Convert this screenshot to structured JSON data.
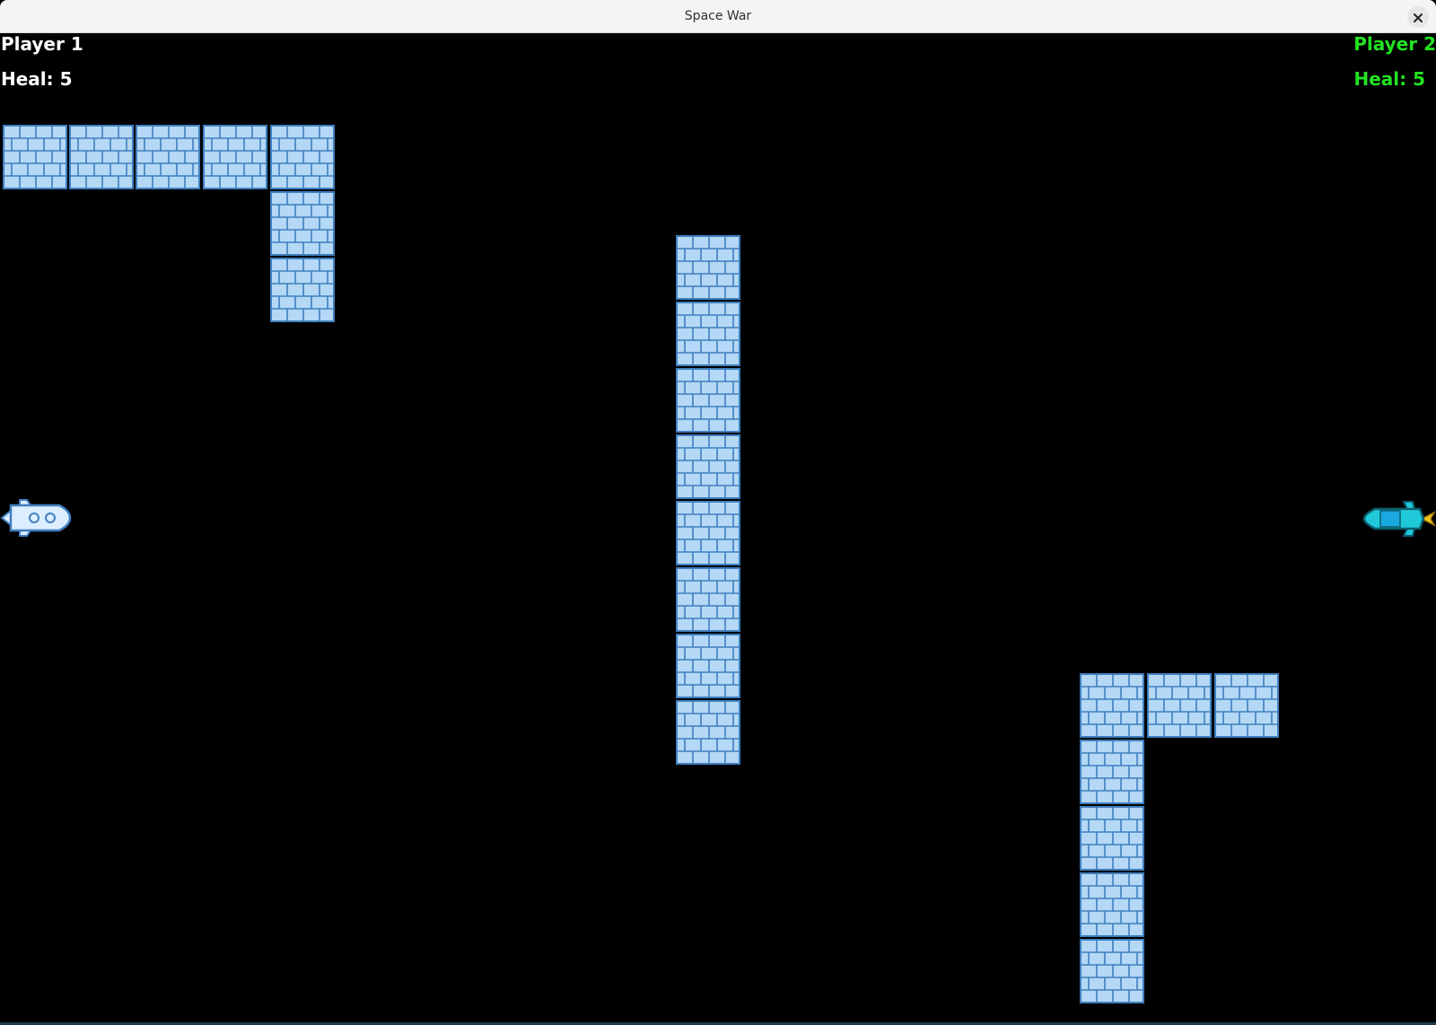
{
  "window": {
    "title": "Space War",
    "close_icon": "close-icon"
  },
  "hud": {
    "player1": {
      "name": "Player 1",
      "heal": "Heal: 5",
      "color": "#ffffff"
    },
    "player2": {
      "name": "Player 2",
      "heal": "Heal: 5",
      "color": "#22e322"
    }
  },
  "colors": {
    "background": "#000000",
    "brick_fill": "#b4d8f5",
    "brick_mortar": "#3f7fbf",
    "ship1_fill": "#dceeff",
    "ship2_fill": "#1fc9d9"
  },
  "sprites": {
    "wall_block": "brick-wall-icon",
    "player1_ship": "rocket-ship-icon",
    "player2_ship": "rocket-ship-icon"
  }
}
